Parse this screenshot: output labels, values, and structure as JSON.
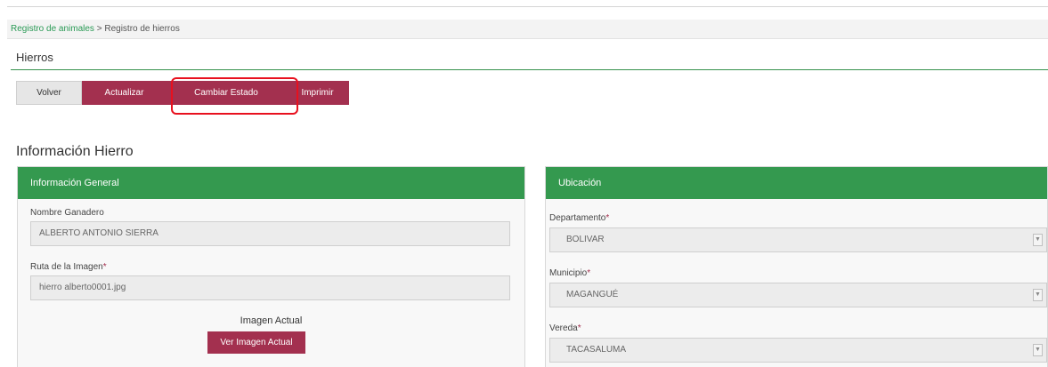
{
  "breadcrumb": {
    "parent": "Registro de animales",
    "separator": ">",
    "current": "Registro de hierros"
  },
  "page_title": "Hierros",
  "toolbar": {
    "back_label": "Volver",
    "update_label": "Actualizar",
    "change_state_label": "Cambiar Estado",
    "print_label": "Imprimir"
  },
  "section_title": "Información Hierro",
  "general_panel": {
    "title": "Información General",
    "owner_label": "Nombre Ganadero",
    "owner_value": "ALBERTO ANTONIO SIERRA",
    "image_path_label": "Ruta de la Imagen",
    "image_path_value": "hierro alberto0001.jpg",
    "current_image_caption": "Imagen Actual",
    "view_image_label": "Ver Imagen Actual"
  },
  "location_panel": {
    "title": "Ubicación",
    "department_label": "Departamento",
    "department_value": "BOLIVAR",
    "municipality_label": "Municipio",
    "municipality_value": "MAGANGUÉ",
    "village_label": "Vereda",
    "village_value": "TACASALUMA"
  },
  "required_mark": "*",
  "colors": {
    "brand_green": "#34994f",
    "button_maroon": "#a3304f",
    "highlight_red": "#e8101e"
  }
}
